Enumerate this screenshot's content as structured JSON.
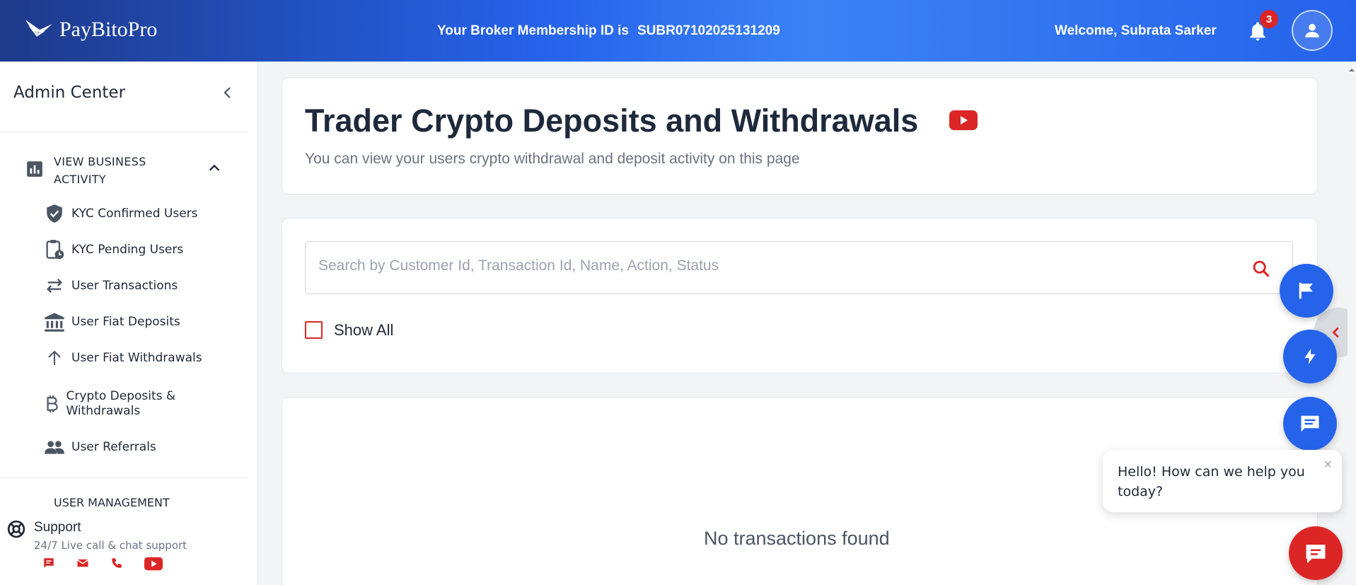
{
  "header": {
    "brand": "PayBitoPro",
    "membership_label": "Your Broker Membership ID is",
    "membership_id": "SUBR07102025131209",
    "welcome": "Welcome, Subrata Sarker",
    "notification_count": "3"
  },
  "sidebar": {
    "title": "Admin Center",
    "section": "VIEW BUSINESS ACTIVITY",
    "items": [
      {
        "label": "KYC Confirmed Users",
        "icon": "shield-check-icon"
      },
      {
        "label": "KYC Pending Users",
        "icon": "clipboard-clock-icon"
      },
      {
        "label": "User Transactions",
        "icon": "swap-arrows-icon"
      },
      {
        "label": "User Fiat Deposits",
        "icon": "bank-icon"
      },
      {
        "label": "User Fiat Withdrawals",
        "icon": "arrow-up-icon"
      },
      {
        "label": "Crypto Deposits & Withdrawals",
        "icon": "bitcoin-icon"
      },
      {
        "label": "User Referrals",
        "icon": "people-icon"
      }
    ],
    "next_section": "USER MANAGEMENT",
    "support": {
      "title": "Support",
      "subtitle": "24/7 Live call & chat support"
    }
  },
  "main": {
    "title": "Trader Crypto Deposits and Withdrawals",
    "subtitle": "You can view your users crypto withdrawal and deposit activity on this page",
    "search_placeholder": "Search by Customer Id, Transaction Id, Name, Action, Status",
    "show_all_label": "Show All",
    "empty_message": "No transactions found"
  },
  "chat": {
    "greeting": "Hello! How can we help you today?"
  },
  "colors": {
    "primary": "#2563eb",
    "accent_red": "#dc2626"
  }
}
